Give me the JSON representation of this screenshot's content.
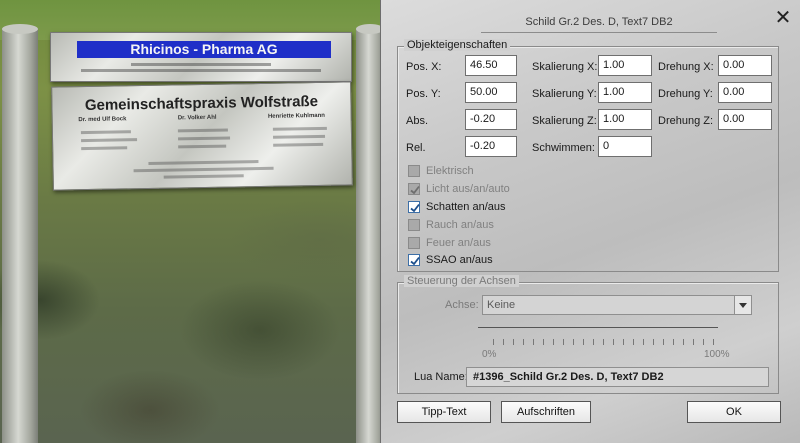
{
  "scene": {
    "sign_top_brand": "Rhicinos - Pharma AG",
    "sign_main_title": "Gemeinschaftspraxis Wolfstraße",
    "sign_doctors": [
      "Dr. med Ulf Bock",
      "Dr. Volker Ahl",
      "Henriette Kuhlmann"
    ]
  },
  "dialog": {
    "title": "Schild Gr.2 Des. D, Text7 DB2",
    "close_label": "✕",
    "object_props": {
      "legend": "Objekteigenschaften",
      "pos_x": {
        "label": "Pos. X:",
        "value": "46.50"
      },
      "pos_y": {
        "label": "Pos. Y:",
        "value": "50.00"
      },
      "abs": {
        "label": "Abs.",
        "value": "-0.20"
      },
      "rel": {
        "label": "Rel.",
        "value": "-0.20"
      },
      "scale_x": {
        "label": "Skalierung X:",
        "value": "1.00"
      },
      "scale_y": {
        "label": "Skalierung Y:",
        "value": "1.00"
      },
      "scale_z": {
        "label": "Skalierung Z:",
        "value": "1.00"
      },
      "swim": {
        "label": "Schwimmen:",
        "value": "0"
      },
      "rot_x": {
        "label": "Drehung X:",
        "value": "0.00"
      },
      "rot_y": {
        "label": "Drehung Y:",
        "value": "0.00"
      },
      "rot_z": {
        "label": "Drehung Z:",
        "value": "0.00"
      },
      "checkboxes": [
        {
          "label": "Elektrisch",
          "checked": false,
          "enabled": false
        },
        {
          "label": "Licht aus/an/auto",
          "checked": true,
          "enabled": false
        },
        {
          "label": "Schatten an/aus",
          "checked": true,
          "enabled": true
        },
        {
          "label": "Rauch an/aus",
          "checked": false,
          "enabled": false
        },
        {
          "label": "Feuer an/aus",
          "checked": false,
          "enabled": false
        },
        {
          "label": "SSAO an/aus",
          "checked": true,
          "enabled": true
        }
      ]
    },
    "axes": {
      "legend": "Steuerung der Achsen",
      "axis_label": "Achse:",
      "axis_value": "Keine",
      "slider_min": "0%",
      "slider_max": "100%",
      "lua_label": "Lua Name:",
      "lua_value": "#1396_Schild Gr.2 Des. D, Text7 DB2"
    },
    "buttons": {
      "tooltip": "Tipp-Text",
      "labels": "Aufschriften",
      "ok": "OK"
    }
  }
}
